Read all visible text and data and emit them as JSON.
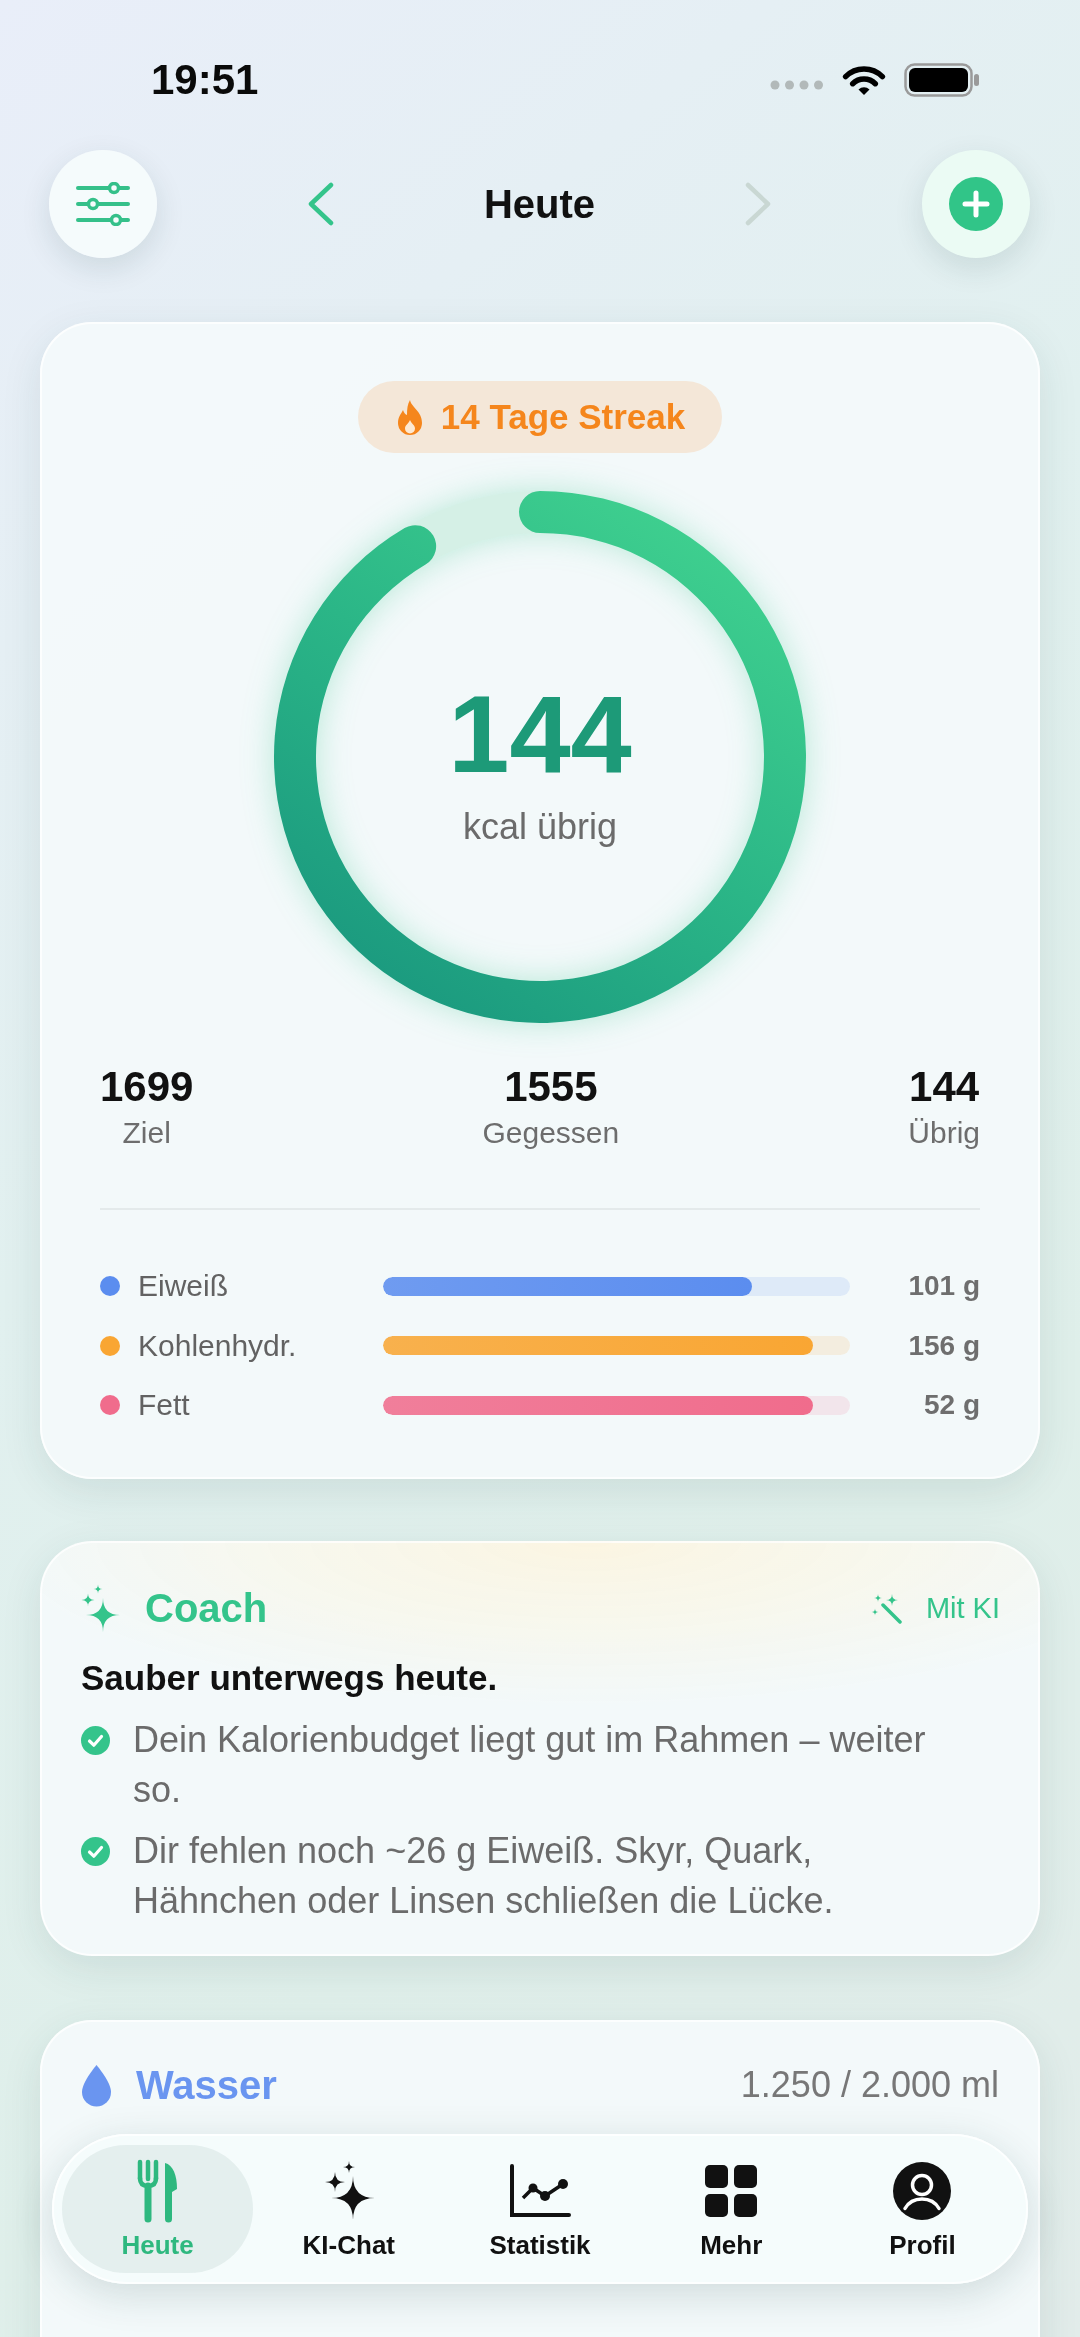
{
  "status_bar": {
    "time": "19:51"
  },
  "header": {
    "title": "Heute",
    "prev": {
      "disabled": false
    },
    "next": {
      "disabled": true
    }
  },
  "summary": {
    "streak": "14 Tage Streak",
    "ring": {
      "chart_data": {
        "type": "donut",
        "values": [
          91.5,
          8.5
        ]
      },
      "value": "144",
      "label": "kcal übrig"
    },
    "stats": [
      {
        "value": "1699",
        "label": "Ziel"
      },
      {
        "value": "1555",
        "label": "Gegessen"
      },
      {
        "value": "144",
        "label": "Übrig"
      }
    ],
    "macros": [
      {
        "name": "Eiweiß",
        "color": "#5b8def",
        "level": 0.79,
        "amount": "101 g"
      },
      {
        "name": "Kohlenhydr.",
        "color": "#f9a633",
        "level": 0.92,
        "amount": "156 g"
      },
      {
        "name": "Fett",
        "color": "#f06c8c",
        "level": 0.92,
        "amount": "52 g"
      }
    ]
  },
  "coach": {
    "title": "Coach",
    "badge": "Mit KI",
    "headline": "Sauber unterwegs heute.",
    "tips": [
      "Dein Kalorienbudget liegt gut im Rahmen – weiter so.",
      "Dir fehlen noch ~26 g Eiweiß. Skyr, Quark, Hähnchen oder Linsen schließen die Lücke."
    ]
  },
  "water": {
    "title": "Wasser",
    "amount": "1.250 / 2.000 ml"
  },
  "tab_bar": {
    "tabs": [
      {
        "label": "Heute",
        "selected": true
      },
      {
        "label": "KI-Chat",
        "selected": false
      },
      {
        "label": "Statistik",
        "selected": false
      },
      {
        "label": "Mehr",
        "selected": false
      },
      {
        "label": "Profil",
        "selected": false
      }
    ]
  }
}
